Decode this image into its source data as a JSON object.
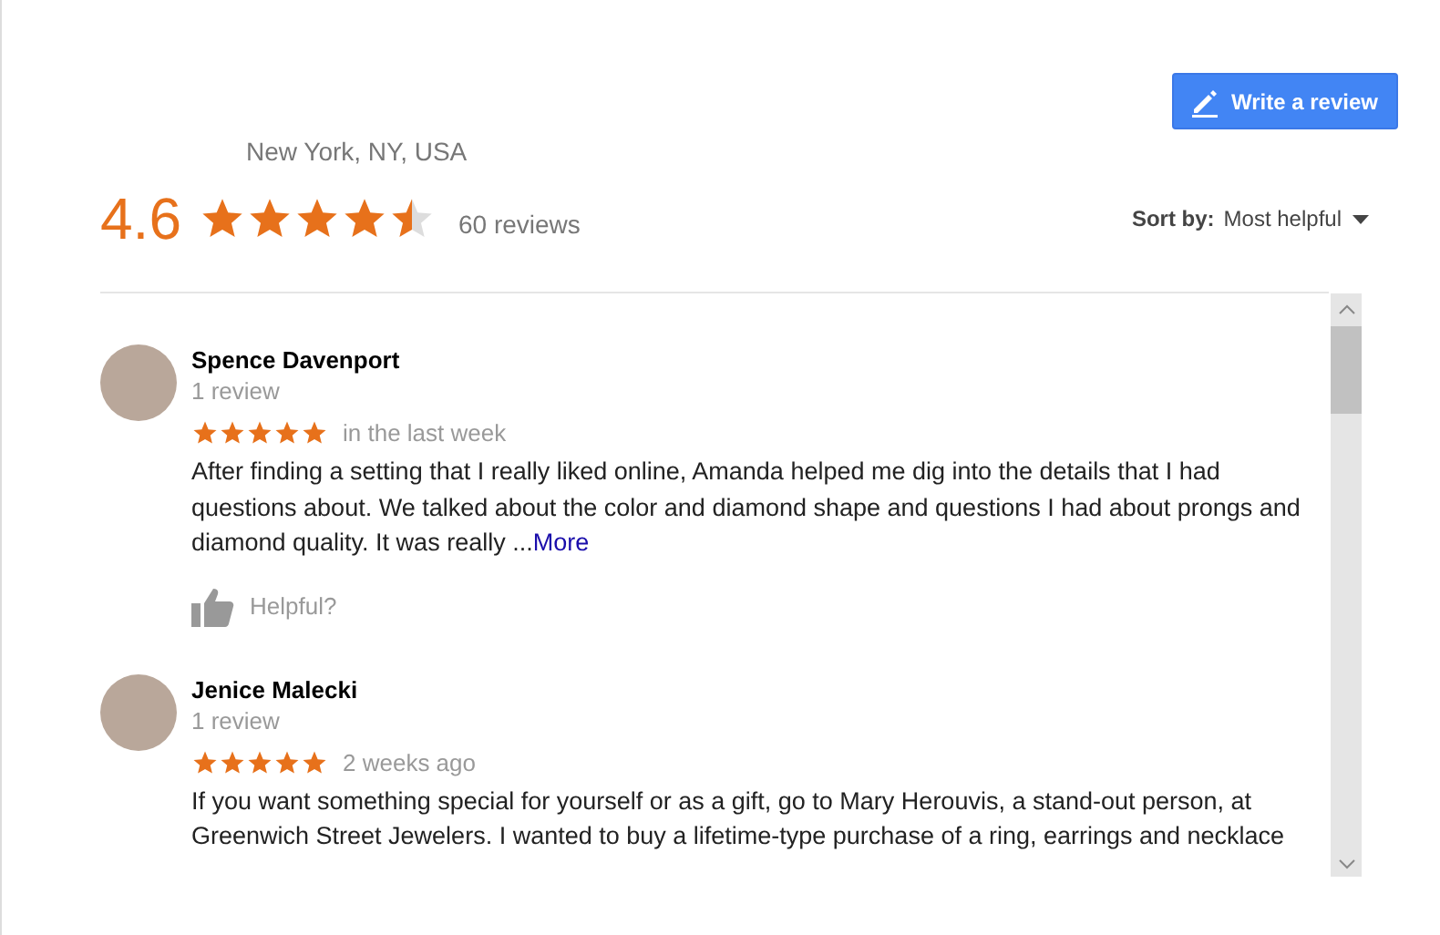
{
  "header": {
    "location": "New York, NY, USA",
    "write_button": "Write a review"
  },
  "summary": {
    "score": "4.6",
    "stars": 4.5,
    "count": "60 reviews"
  },
  "sort": {
    "label": "Sort by:",
    "value": "Most helpful"
  },
  "reviews": [
    {
      "name": "Spence Davenport",
      "review_count": "1 review",
      "stars": 5,
      "time": "in the last week",
      "text": "After finding a setting that I really liked online, Amanda helped me dig into the details that I had questions about. We talked about the color and diamond shape and questions I had about prongs and diamond quality. It was really ...",
      "more": "More",
      "helpful": "Helpful?"
    },
    {
      "name": "Jenice Malecki",
      "review_count": "1 review",
      "stars": 5,
      "time": "2 weeks ago",
      "text": "If you want something special for yourself or as a gift, go to Mary Herouvis, a stand-out person, at Greenwich Street Jewelers.  I wanted to buy a lifetime-type purchase of a ring, earrings and necklace"
    }
  ]
}
